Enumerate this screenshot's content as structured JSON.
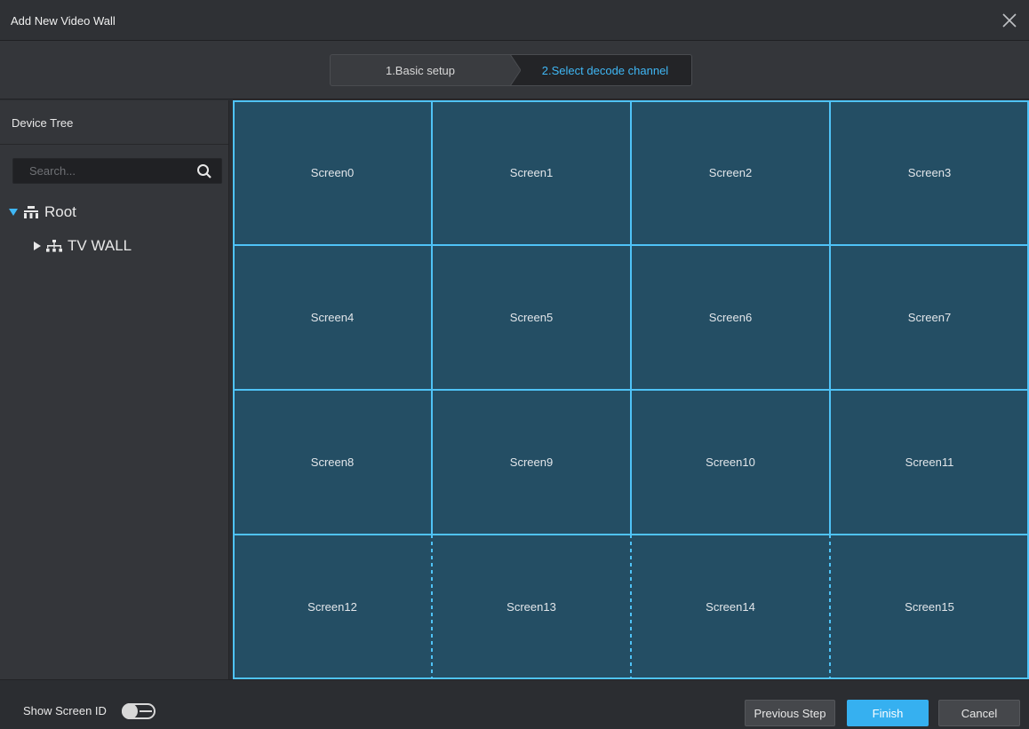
{
  "window": {
    "title": "Add New Video Wall"
  },
  "steps": {
    "step1_label": "1.Basic setup",
    "step2_label": "2.Select decode channel",
    "active": 2
  },
  "sidebar": {
    "title": "Device Tree",
    "search_placeholder": "Search...",
    "tree": [
      {
        "label": "Root",
        "icon": "org-tree-icon",
        "expanded": true
      },
      {
        "label": "TV WALL",
        "icon": "network-tree-icon",
        "expanded": false
      }
    ]
  },
  "screens": [
    "Screen0",
    "Screen1",
    "Screen2",
    "Screen3",
    "Screen4",
    "Screen5",
    "Screen6",
    "Screen7",
    "Screen8",
    "Screen9",
    "Screen10",
    "Screen11",
    "Screen12",
    "Screen13",
    "Screen14",
    "Screen15"
  ],
  "footer": {
    "show_screen_id_label": "Show Screen ID",
    "show_screen_id_on": false,
    "previous_label": "Previous Step",
    "finish_label": "Finish",
    "cancel_label": "Cancel"
  },
  "colors": {
    "accent": "#36b0f0",
    "grid_fill": "#244e64",
    "grid_line": "#4fc3f7",
    "active_step_text": "#3fb7f5"
  }
}
